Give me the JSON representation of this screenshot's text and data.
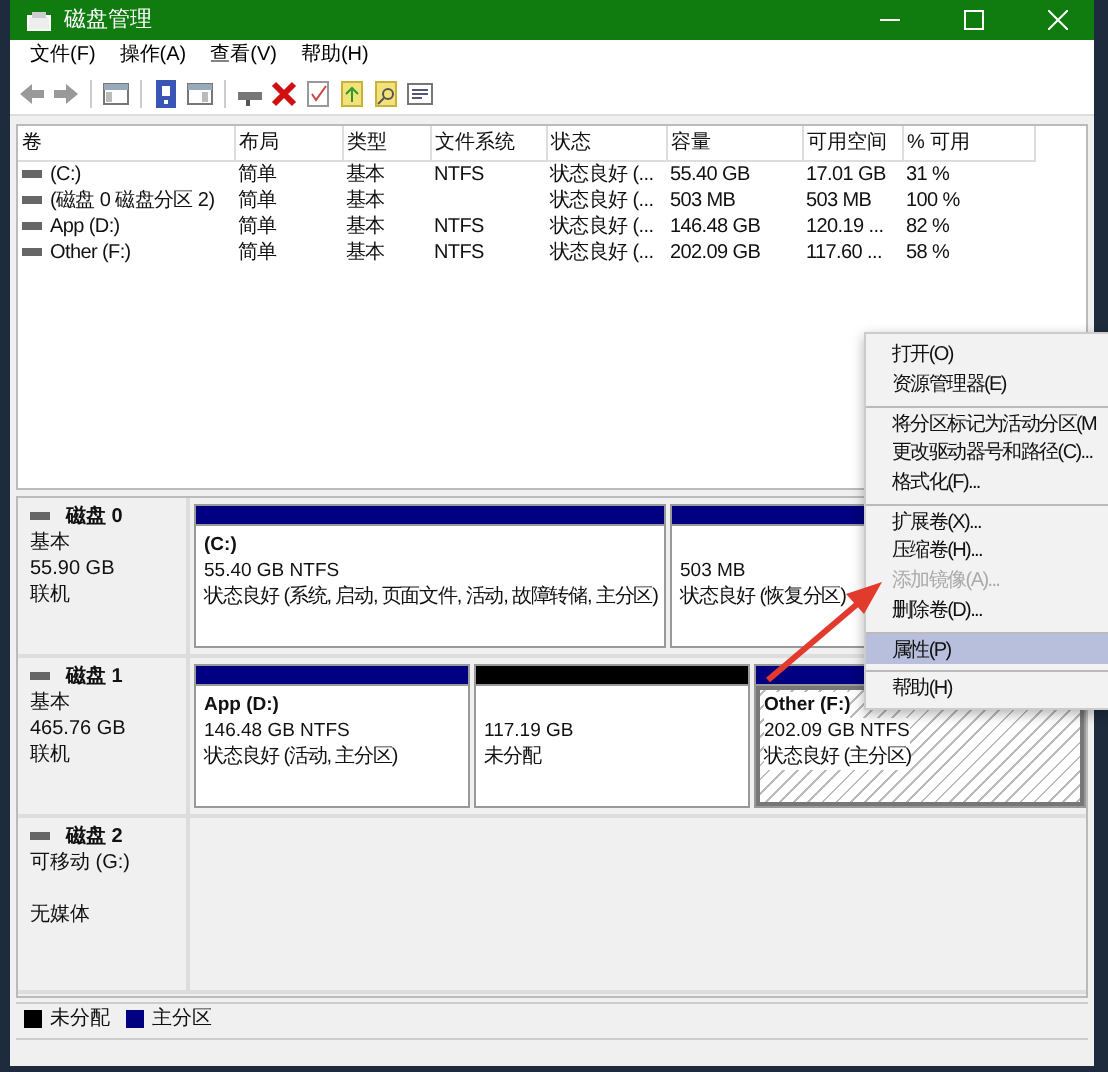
{
  "window": {
    "title": "磁盘管理"
  },
  "menu": [
    "文件(F)",
    "操作(A)",
    "查看(V)",
    "帮助(H)"
  ],
  "volumes": {
    "columns": [
      "卷",
      "布局",
      "类型",
      "文件系统",
      "状态",
      "容量",
      "可用空间",
      "% 可用"
    ],
    "rows": [
      [
        "(C:)",
        "简单",
        "基本",
        "NTFS",
        "状态良好 (...",
        "55.40 GB",
        "17.01 GB",
        "31 %"
      ],
      [
        "(磁盘 0 磁盘分区 2)",
        "简单",
        "基本",
        null,
        "状态良好 (...",
        "503 MB",
        "503 MB",
        "100 %"
      ],
      [
        "App (D:)",
        "简单",
        "基本",
        "NTFS",
        "状态良好 (...",
        "146.48 GB",
        "120.19 ...",
        "82 %"
      ],
      [
        "Other (F:)",
        "简单",
        "基本",
        "NTFS",
        "状态良好 (...",
        "202.09 GB",
        "117.60 ...",
        "58 %"
      ]
    ]
  },
  "disks": [
    {
      "name": "磁盘 0",
      "type": "基本",
      "size": "55.90 GB",
      "state": "联机",
      "partitions": [
        {
          "kind": "primary",
          "name": "(C:)",
          "size": "55.40 GB NTFS",
          "status": "状态良好 (系统, 启动, 页面文件, 活动, 故障转储, 主分区)",
          "selected": false
        },
        {
          "kind": "primary",
          "size": "503 MB",
          "status": "状态良好 (恢复分区)",
          "selected": false
        }
      ]
    },
    {
      "name": "磁盘 1",
      "type": "基本",
      "size": "465.76 GB",
      "state": "联机",
      "partitions": [
        {
          "kind": "primary",
          "name": "App (D:)",
          "size": "146.48 GB NTFS",
          "status": "状态良好 (活动, 主分区)",
          "selected": false
        },
        {
          "kind": "unallocated",
          "size": "117.19 GB",
          "status": "未分配",
          "selected": false
        },
        {
          "kind": "primary",
          "name": "Other (F:)",
          "size": "202.09 GB NTFS",
          "status": "状态良好 (主分区)",
          "selected": true
        }
      ]
    },
    {
      "name": "磁盘 2",
      "type": "可移动 (G:)",
      "state": "无媒体"
    }
  ],
  "legend": [
    {
      "label": "未分配",
      "color": "#000000"
    },
    {
      "label": "主分区",
      "color": "#000080"
    }
  ],
  "context_menu": {
    "items": [
      {
        "label": "打开(O)",
        "separator_before": false,
        "disabled": false,
        "selected": false
      },
      {
        "label": "资源管理器(E)",
        "separator_before": false,
        "disabled": false,
        "selected": false
      },
      {
        "label": "将分区标记为活动分区(M",
        "separator_before": true,
        "disabled": false,
        "selected": false
      },
      {
        "label": "更改驱动器号和路径(C)...",
        "separator_before": false,
        "disabled": false,
        "selected": false
      },
      {
        "label": "格式化(F)...",
        "separator_before": false,
        "disabled": false,
        "selected": false
      },
      {
        "label": "扩展卷(X)...",
        "separator_before": true,
        "disabled": false,
        "selected": false
      },
      {
        "label": "压缩卷(H)...",
        "separator_before": false,
        "disabled": false,
        "selected": false
      },
      {
        "label": "添加镜像(A)...",
        "separator_before": false,
        "disabled": true,
        "selected": false
      },
      {
        "label": "删除卷(D)...",
        "separator_before": false,
        "disabled": false,
        "selected": false
      },
      {
        "label": "属性(P)",
        "separator_before": true,
        "disabled": false,
        "selected": true
      },
      {
        "label": "帮助(H)",
        "separator_before": true,
        "disabled": false,
        "selected": false
      }
    ]
  }
}
